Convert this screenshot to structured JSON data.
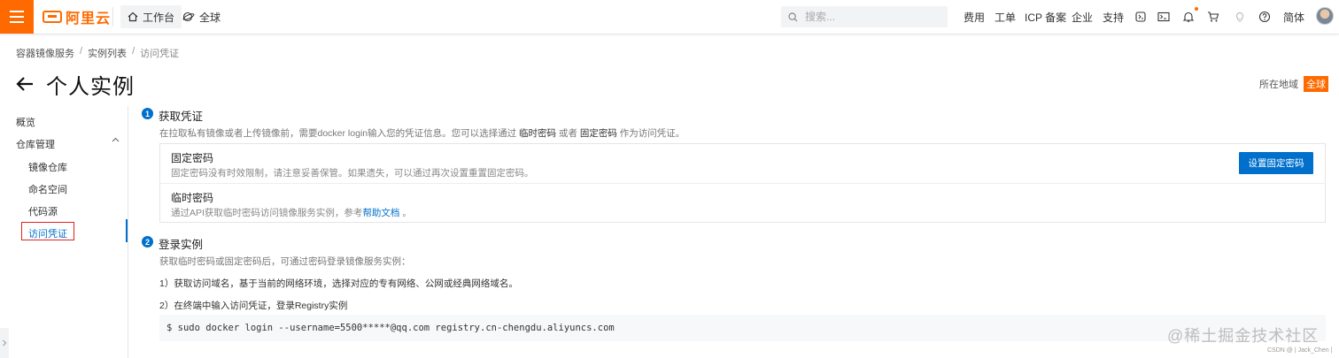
{
  "topbar": {
    "logo_text": "阿里云",
    "workbench": "工作台",
    "global": "全球",
    "search_placeholder": "搜索...",
    "nav": [
      "费用",
      "工单",
      "ICP 备案",
      "企业",
      "支持"
    ],
    "lang": "简体"
  },
  "breadcrumb": [
    "容器镜像服务",
    "实例列表",
    "访问凭证"
  ],
  "page": {
    "title": "个人实例",
    "region_label": "所在地域",
    "region_value": "全球"
  },
  "sidebar": {
    "overview": "概览",
    "repo_mgmt": "仓库管理",
    "image_repo": "镜像仓库",
    "namespace": "命名空间",
    "code_source": "代码源",
    "access_credential": "访问凭证"
  },
  "step1": {
    "num": "1",
    "title": "获取凭证",
    "desc_a": "在拉取私有镜像或者上传镜像前，需要docker login输入您的凭证信息。您可以选择通过 ",
    "desc_temp": "临时密码",
    "desc_or": " 或者 ",
    "desc_fixed": "固定密码",
    "desc_b": " 作为访问凭证。",
    "fixed_title": "固定密码",
    "fixed_desc": "固定密码没有时效限制，请注意妥善保管。如果遗失，可以通过再次设置重置固定密码。",
    "set_button": "设置固定密码",
    "temp_title": "临时密码",
    "temp_desc_a": "通过API获取临时密码访问镜像服务实例，参考",
    "temp_link": "帮助文档",
    "temp_desc_b": " 。"
  },
  "step2": {
    "num": "2",
    "title": "登录实例",
    "desc": "获取临时密码或固定密码后，可通过密码登录镜像服务实例：",
    "line1": "1）获取访问域名，基于当前的网络环境，选择对应的专有网络、公网或经典网络域名。",
    "line2": "2）在终端中输入访问凭证，登录Registry实例",
    "command": "$ sudo docker login --username=5500*****@qq.com registry.cn-chengdu.aliyuncs.com"
  },
  "watermark": "@稀土掘金技术社区",
  "csdn_mark": "CSDN @ | Jack_Chen |",
  "colors": {
    "brand": "#ff6a00",
    "primary": "#0070cc"
  }
}
